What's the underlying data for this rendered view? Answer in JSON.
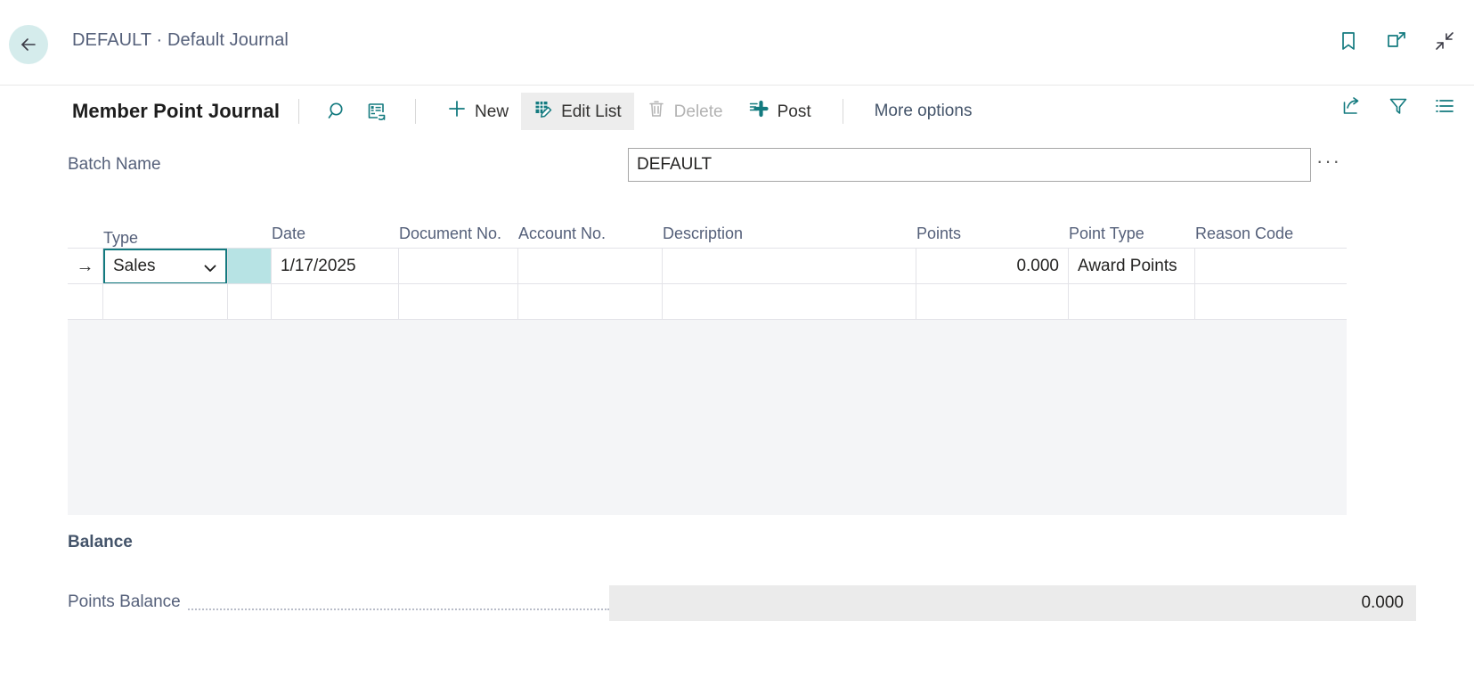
{
  "header": {
    "back_icon": "arrow-left-icon",
    "breadcrumb": "DEFAULT · Default Journal",
    "icons": [
      {
        "name": "bookmark-icon",
        "label": "Bookmark"
      },
      {
        "name": "open-in-new-window-icon",
        "label": "Open in new window"
      },
      {
        "name": "collapse-icon",
        "label": "Collapse"
      }
    ]
  },
  "toolbar": {
    "title": "Member Point Journal",
    "search_icon": "search-icon",
    "open_in_excel_icon": "open-in-excel-icon",
    "commands": [
      {
        "name": "new-button",
        "label": "New",
        "icon": "plus-icon",
        "state": "enabled"
      },
      {
        "name": "edit-list-button",
        "label": "Edit List",
        "icon": "edit-list-icon",
        "state": "active"
      },
      {
        "name": "delete-button",
        "label": "Delete",
        "icon": "trash-icon",
        "state": "disabled"
      },
      {
        "name": "post-button",
        "label": "Post",
        "icon": "post-icon",
        "state": "enabled"
      }
    ],
    "more_options": "More options",
    "right_icons": [
      {
        "name": "share-icon",
        "label": "Share"
      },
      {
        "name": "filter-icon",
        "label": "Filter"
      },
      {
        "name": "list-view-icon",
        "label": "Show list"
      }
    ]
  },
  "batch": {
    "label": "Batch Name",
    "value": "DEFAULT",
    "placeholder": "",
    "ellipsis": "···"
  },
  "grid": {
    "columns": [
      {
        "key": "indicator",
        "label": ""
      },
      {
        "key": "type",
        "label": "Type"
      },
      {
        "key": "selected",
        "label": ""
      },
      {
        "key": "date",
        "label": "Date"
      },
      {
        "key": "document_no",
        "label": "Document No."
      },
      {
        "key": "account_no",
        "label": "Account No."
      },
      {
        "key": "description",
        "label": "Description"
      },
      {
        "key": "points",
        "label": "Points"
      },
      {
        "key": "point_type",
        "label": "Point Type"
      },
      {
        "key": "reason_code",
        "label": "Reason Code"
      }
    ],
    "rows": [
      {
        "indicator": "→",
        "type": "Sales",
        "type_options": [
          "Sales"
        ],
        "selected": "",
        "date": "1/17/2025",
        "document_no": "",
        "account_no": "",
        "description": "",
        "points": "0.000",
        "point_type": "Award Points",
        "reason_code": ""
      },
      {
        "indicator": "",
        "type": "",
        "selected": "",
        "date": "",
        "document_no": "",
        "account_no": "",
        "description": "",
        "points": "",
        "point_type": "",
        "reason_code": ""
      }
    ]
  },
  "balance": {
    "heading": "Balance",
    "points_balance_label": "Points Balance",
    "points_balance_value": "0.000"
  },
  "colors": {
    "accent_teal": "#137a7f",
    "back_circle": "#d5ecec",
    "selected_cell": "#b7e3e4",
    "label_gray_blue": "#55607a",
    "grid_filler": "#f4f5f7",
    "readonly_field": "#ebebeb"
  }
}
